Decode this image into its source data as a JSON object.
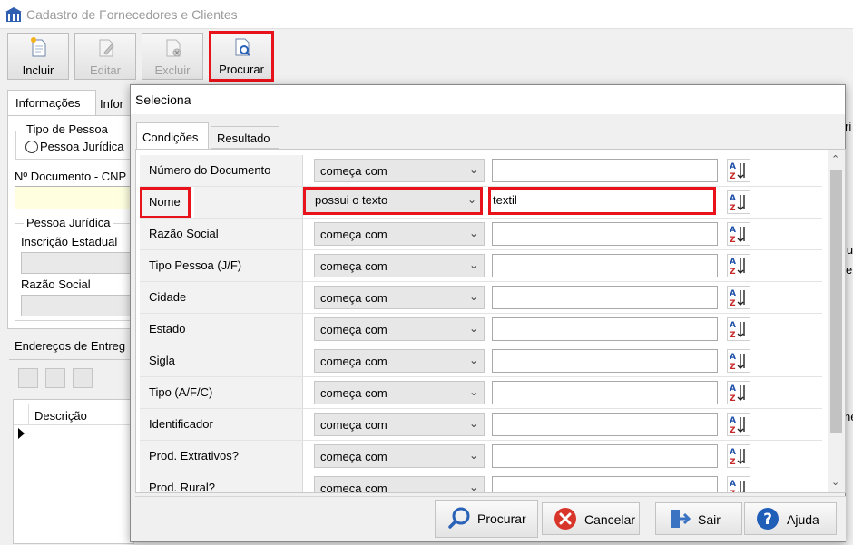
{
  "window": {
    "title": "Cadastro de Fornecedores e Clientes"
  },
  "toolbar": {
    "incluir": "Incluir",
    "editar": "Editar",
    "excluir": "Excluir",
    "procurar": "Procurar"
  },
  "background_form": {
    "tab_informacoes": "Informações",
    "tab_info2": "Infor",
    "tipo_pessoa": "Tipo de Pessoa",
    "pessoa_juridica_radio": "Pessoa Jurídica",
    "n_documento": "Nº Documento - CNP",
    "pessoa_juridica_group": "Pessoa Jurídica",
    "inscricao_estadual": "Inscrição Estadual",
    "razao_social": "Razão Social",
    "enderecos": "Endereços de Entreg",
    "descricao": "Descrição",
    "right_frag_1": "ri",
    "right_frag_2": "lu",
    "right_frag_3": "e",
    "right_frag_4": "ne"
  },
  "dialog": {
    "title": "Seleciona",
    "tabs": {
      "condicoes": "Condições",
      "resultado": "Resultado"
    },
    "rows": [
      {
        "label": "Número do Documento",
        "operator": "começa com",
        "value": ""
      },
      {
        "label": "Nome",
        "operator": "possui o texto",
        "value": "textil"
      },
      {
        "label": "Razão Social",
        "operator": "começa com",
        "value": ""
      },
      {
        "label": "Tipo Pessoa (J/F)",
        "operator": "começa com",
        "value": ""
      },
      {
        "label": "Cidade",
        "operator": "começa com",
        "value": ""
      },
      {
        "label": "Estado",
        "operator": "começa com",
        "value": ""
      },
      {
        "label": "Sigla",
        "operator": "começa com",
        "value": ""
      },
      {
        "label": "Tipo (A/F/C)",
        "operator": "começa com",
        "value": ""
      },
      {
        "label": "Identificador",
        "operator": "começa com",
        "value": ""
      },
      {
        "label": "Prod. Extrativos?",
        "operator": "começa com",
        "value": ""
      },
      {
        "label": "Prod. Rural?",
        "operator": "começa com",
        "value": ""
      }
    ],
    "buttons": {
      "procurar": "Procurar",
      "cancelar": "Cancelar",
      "sair": "Sair",
      "ajuda": "Ajuda"
    }
  },
  "colors": {
    "highlight": "#e8121a",
    "accent_blue": "#2a62b8",
    "cancel_red": "#d9362b",
    "input_yellow": "#ffffe0"
  }
}
